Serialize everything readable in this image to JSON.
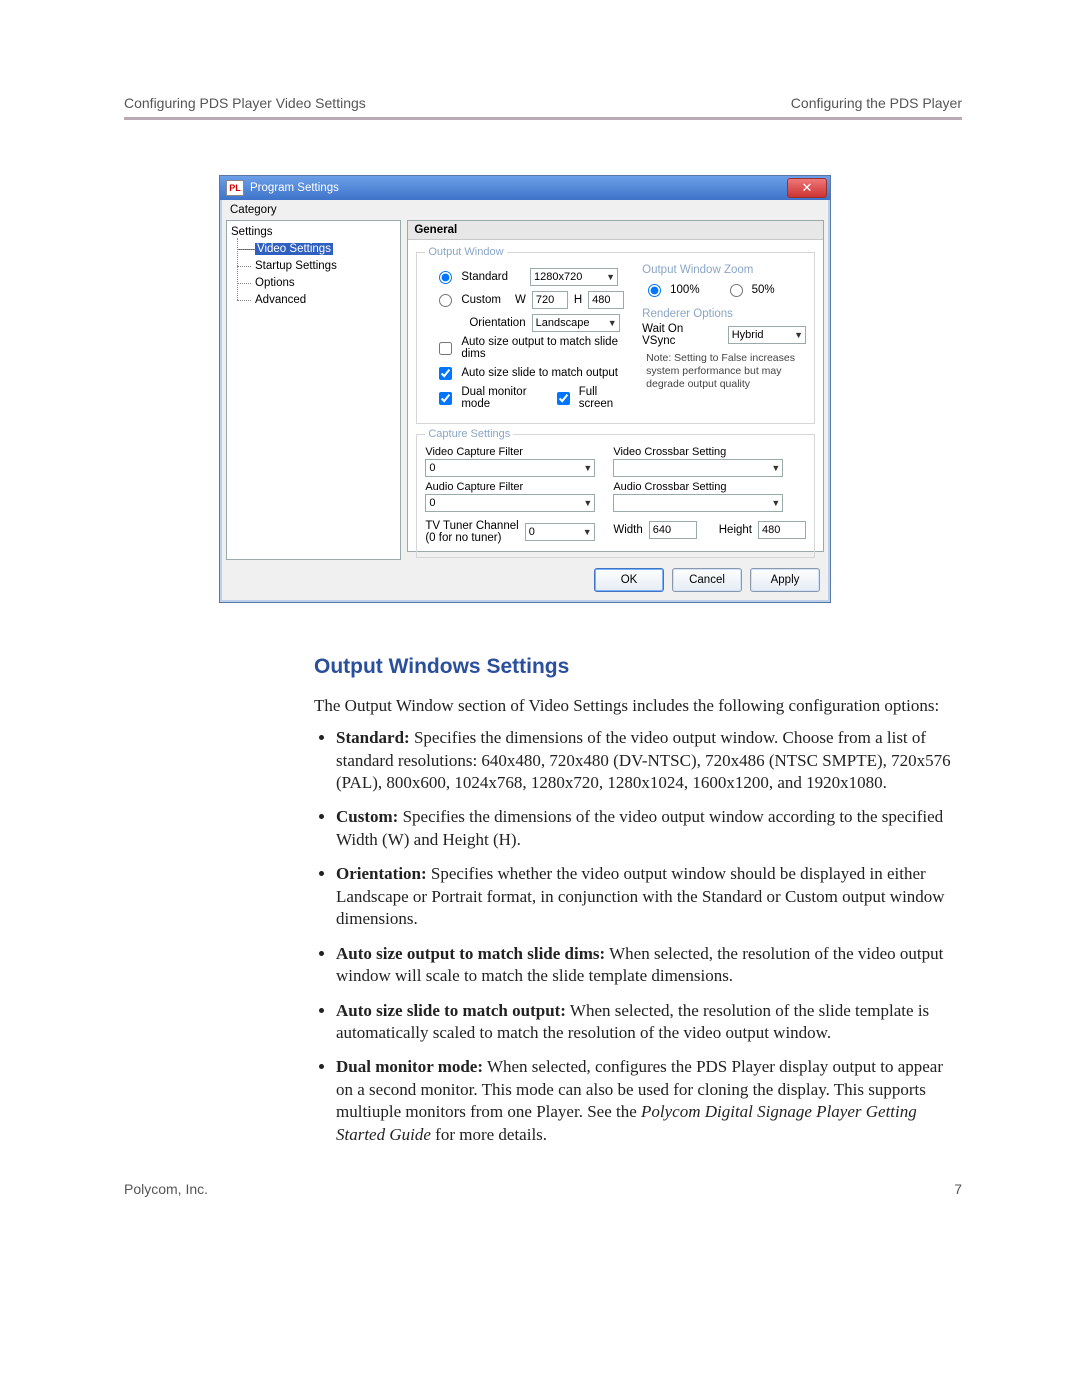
{
  "header": {
    "left": "Configuring PDS Player Video Settings",
    "right": "Configuring the PDS Player"
  },
  "footer": {
    "left": "Polycom, Inc.",
    "right": "7"
  },
  "dialog": {
    "title": "Program Settings",
    "icon_text": "PL",
    "category_label": "Category",
    "tree": {
      "root": "Settings",
      "items": [
        "Video Settings",
        "Startup Settings",
        "Options",
        "Advanced"
      ],
      "selected": 0
    },
    "pane_title": "General",
    "output_window_legend": "Output Window",
    "standard_label": "Standard",
    "standard_value": "1280x720",
    "custom_label": "Custom",
    "custom_w_label": "W",
    "custom_w_value": "720",
    "custom_h_label": "H",
    "custom_h_value": "480",
    "orientation_label": "Orientation",
    "orientation_value": "Landscape",
    "cb_auto_output": "Auto size output to match slide dims",
    "cb_auto_slide": "Auto size slide to match output",
    "cb_dual": "Dual monitor mode",
    "cb_full": "Full screen",
    "zoom_legend": "Output Window Zoom",
    "zoom_100": "100%",
    "zoom_50": "50%",
    "renderer_legend": "Renderer Options",
    "vsync_label": "Wait On VSync",
    "vsync_value": "Hybrid",
    "vsync_note": "Note: Setting to False increases system performance but may degrade output quality",
    "capture_legend": "Capture Settings",
    "vid_filter_label": "Video Capture Filter",
    "vid_filter_value": "0",
    "aud_filter_label": "Audio Capture Filter",
    "aud_filter_value": "0",
    "vid_xbar_label": "Video Crossbar Setting",
    "vid_xbar_value": "",
    "aud_xbar_label": "Audio Crossbar Setting",
    "aud_xbar_value": "",
    "tuner_label": "TV Tuner Channel (0 for no tuner)",
    "tuner_label_line1": "TV Tuner Channel",
    "tuner_label_line2": "(0 for no tuner)",
    "tuner_value": "0",
    "width_label": "Width",
    "width_value": "640",
    "height_label": "Height",
    "height_value": "480",
    "buttons": {
      "ok": "OK",
      "cancel": "Cancel",
      "apply": "Apply"
    }
  },
  "doc": {
    "heading": "Output Windows Settings",
    "intro": "The Output Window section of Video Settings includes the following configuration options:",
    "items": [
      {
        "b": "Standard:",
        "t": " Specifies the dimensions of the video output window. Choose from a list of standard resolutions: 640x480, 720x480 (DV-NTSC), 720x486 (NTSC SMPTE), 720x576 (PAL), 800x600, 1024x768, 1280x720, 1280x1024, 1600x1200, and 1920x1080."
      },
      {
        "b": "Custom:",
        "t": " Specifies the dimensions of the video output window according to the specified Width (W) and Height (H)."
      },
      {
        "b": "Orientation:",
        "t": " Specifies whether the video output window should be displayed in either Landscape or Portrait format, in conjunction with the Standard or Custom output window dimensions."
      },
      {
        "b": "Auto size output to match slide dims:",
        "t": " When selected, the resolution of the video output window will scale to match the slide template dimensions."
      },
      {
        "b": "Auto size slide to match output:",
        "t": " When selected, the resolution of the slide template is automatically scaled to match the resolution of the video output window."
      },
      {
        "b": "Dual monitor mode:",
        "t": " When selected, configures the PDS Player display output to appear on a second monitor. This mode can also be used for cloning the display. This supports multiuple monitors from one Player. See the ",
        "em": "Polycom Digital Signage Player Getting Started Guide",
        "t2": " for more details."
      }
    ]
  }
}
